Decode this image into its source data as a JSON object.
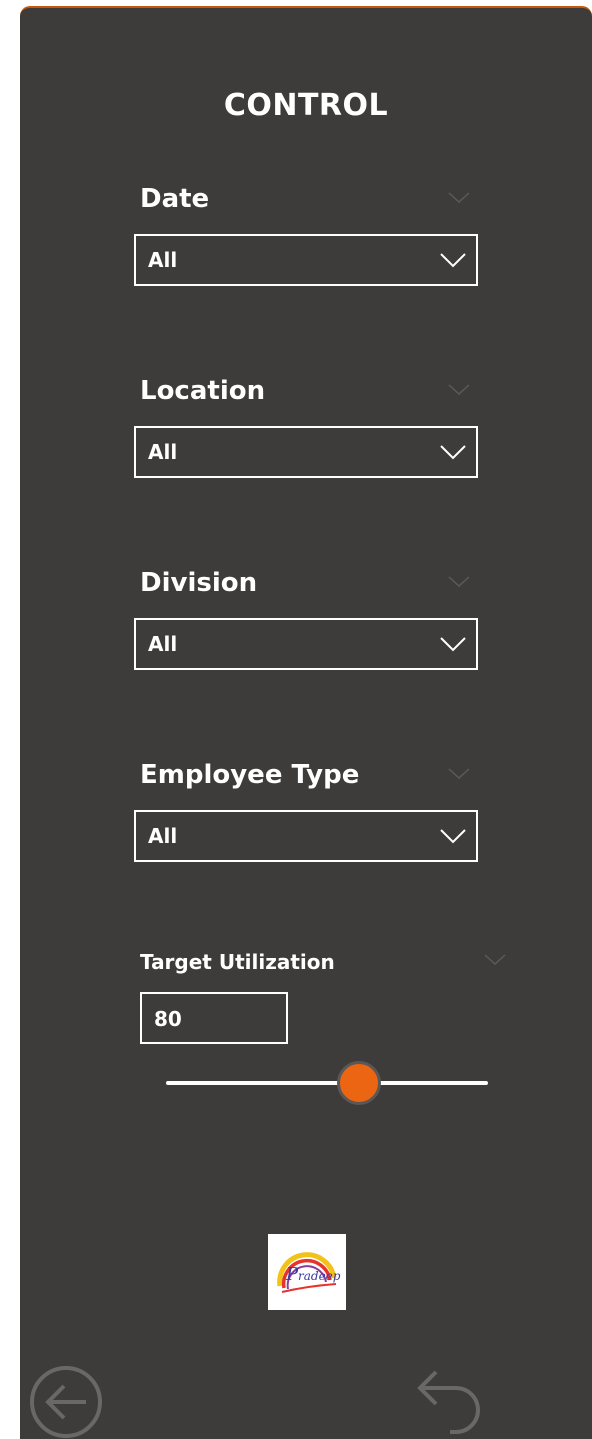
{
  "header": {
    "title": "CONTROL"
  },
  "slicers": [
    {
      "label": "Date",
      "value": "All"
    },
    {
      "label": "Location",
      "value": "All"
    },
    {
      "label": "Division",
      "value": "All"
    },
    {
      "label": "Employee Type",
      "value": "All"
    }
  ],
  "target": {
    "label": "Target Utilization",
    "value": "80",
    "slider_fraction": 0.6
  },
  "colors": {
    "panel": "#3d3c3a",
    "accent": "#ec6512",
    "border_top": "#c25a0a",
    "text": "#ffffff"
  },
  "icons": {
    "chevron": "chevron-down-icon",
    "back": "back-arrow-circle-icon",
    "undo": "undo-icon"
  }
}
